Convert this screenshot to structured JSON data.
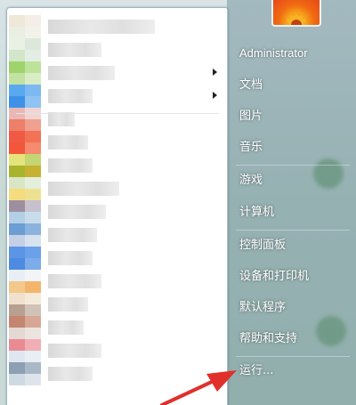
{
  "start_menu": {
    "right_pane": {
      "user_name": "Administrator",
      "items": [
        {
          "label": "文档"
        },
        {
          "label": "图片"
        },
        {
          "label": "音乐"
        },
        {
          "label": "游戏"
        },
        {
          "label": "计算机"
        },
        {
          "label": "控制面板"
        },
        {
          "label": "设备和打印机"
        },
        {
          "label": "默认程序"
        },
        {
          "label": "帮助和支持"
        },
        {
          "label": "运行..."
        }
      ]
    },
    "left_pane": {
      "note_blurred_items": ""
    }
  },
  "colors": {
    "annotation_arrow": "#e0302c",
    "right_pane_text": "#ffffff"
  }
}
